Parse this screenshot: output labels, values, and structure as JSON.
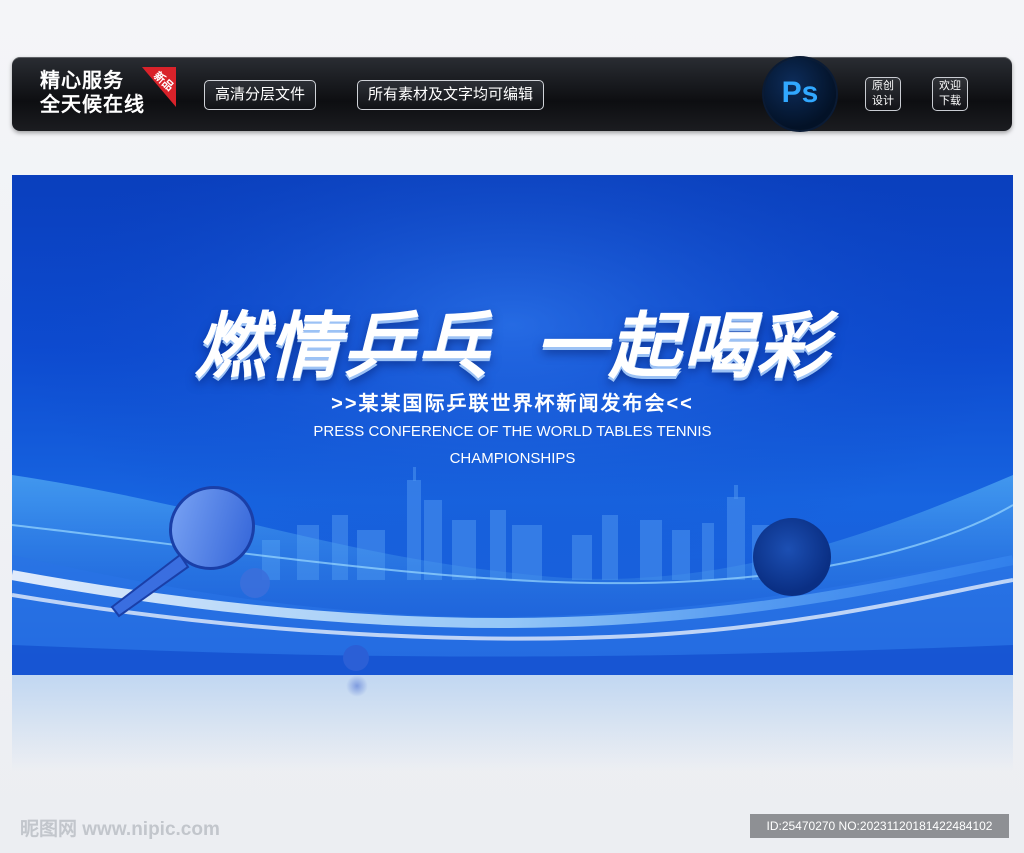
{
  "promo_bar": {
    "slogan_line1": "精心服务",
    "slogan_line2": "全天候在线",
    "badge": "新品",
    "tag1": "高清分层文件",
    "tag2": "所有素材及文字均可编辑",
    "ps_label": "Ps",
    "original_line1": "原创",
    "original_line2": "设计",
    "download_line1": "欢迎",
    "download_line2": "下载"
  },
  "banner": {
    "headline_part1": "燃情乒乓",
    "headline_part2": "一起喝彩",
    "subtitle_cn": ">>某某国际乒联世界杯新闻发布会<<",
    "subtitle_en_line1": "PRESS CONFERENCE OF THE WORLD TABLES TENNIS",
    "subtitle_en_line2": "CHAMPIONSHIPS"
  },
  "watermark": {
    "site": "昵图网 www.nipic.com",
    "id_text": "ID:25470270 NO:20231120181422484102"
  },
  "colors": {
    "banner_blue": "#0d4bd0",
    "badge_red": "#d9222a",
    "ps_blue": "#31a8ff"
  },
  "icons": [
    "ps-logo-icon",
    "paddle-icon",
    "ball-icon",
    "skyline-icon"
  ]
}
